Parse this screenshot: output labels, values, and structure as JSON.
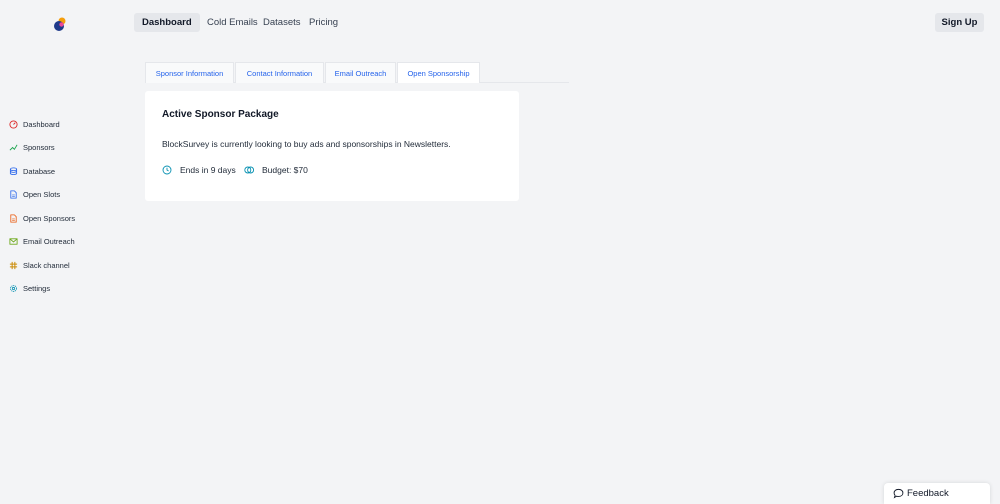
{
  "nav": {
    "dashboard": "Dashboard",
    "cold_emails": "Cold Emails",
    "datasets": "Datasets",
    "pricing": "Pricing",
    "signup": "Sign Up"
  },
  "sidebar": {
    "items": [
      {
        "label": "Dashboard",
        "icon": "dashboard-icon",
        "color": "#dc2626"
      },
      {
        "label": "Sponsors",
        "icon": "sponsors-icon",
        "color": "#16a34a"
      },
      {
        "label": "Database",
        "icon": "database-icon",
        "color": "#2563eb"
      },
      {
        "label": "Open Slots",
        "icon": "document-icon",
        "color": "#2563eb"
      },
      {
        "label": "Open Sponsors",
        "icon": "document-icon",
        "color": "#ea580c"
      },
      {
        "label": "Email Outreach",
        "icon": "mail-icon",
        "color": "#65a30d"
      },
      {
        "label": "Slack channel",
        "icon": "slack-icon",
        "color": "#ca8a04"
      },
      {
        "label": "Settings",
        "icon": "gear-icon",
        "color": "#0891b2"
      }
    ]
  },
  "tabs": [
    {
      "label": "Sponsor Information"
    },
    {
      "label": "Contact Information"
    },
    {
      "label": "Email Outreach"
    },
    {
      "label": "Open Sponsorship"
    }
  ],
  "card": {
    "title": "Active Sponsor Package",
    "description": "BlockSurvey is currently looking to buy ads and sponsorships in Newsletters.",
    "ends": "Ends in 9 days",
    "budget": "Budget: $70"
  },
  "feedback": "Feedback",
  "colors": {
    "accent": "#2563eb",
    "meta_icon": "#0891b2"
  }
}
